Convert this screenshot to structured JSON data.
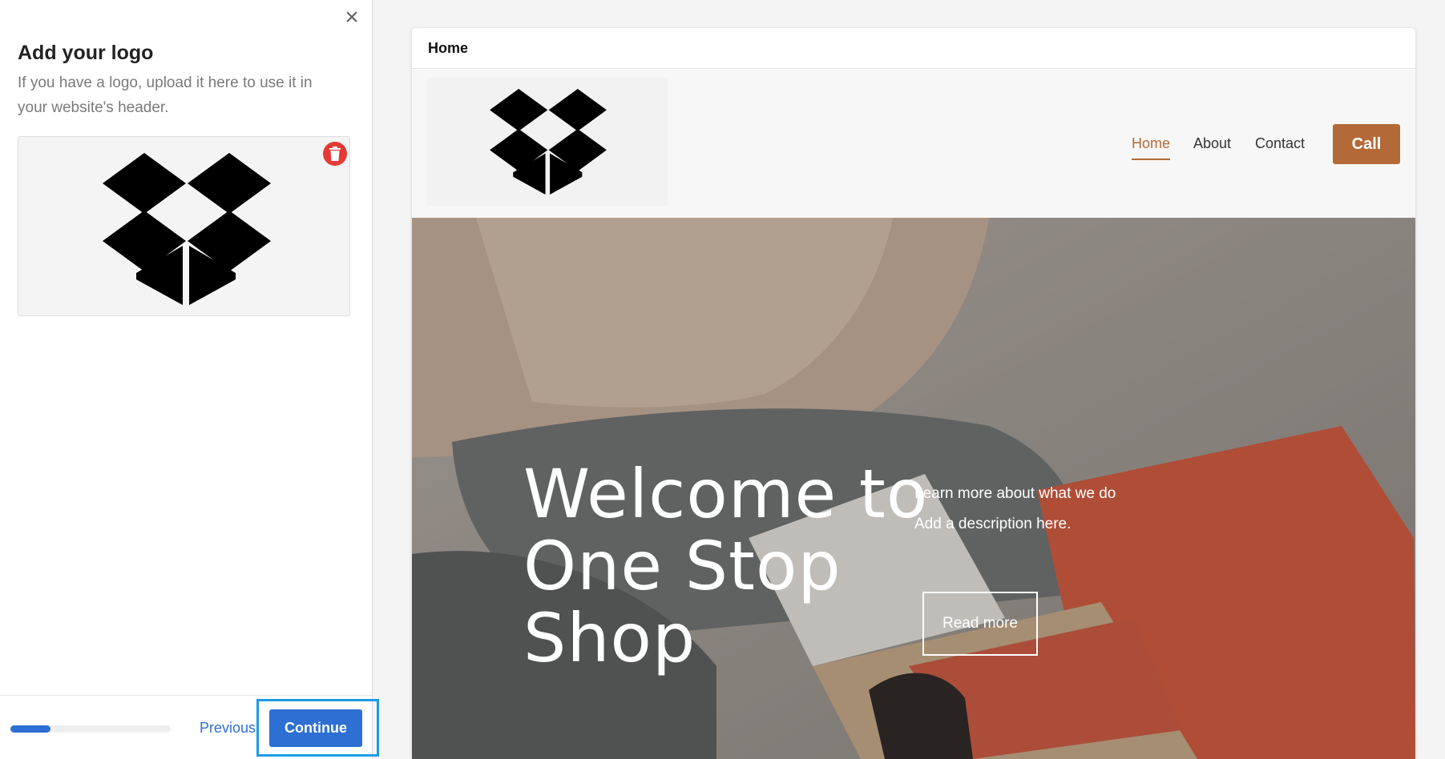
{
  "panel": {
    "title": "Add your logo",
    "description": "If you have a logo, upload it here to use it in your website's header.",
    "close_icon": "close-icon",
    "trash_icon": "trash-icon",
    "progress": 0.25,
    "previous_label": "Previous",
    "continue_label": "Continue"
  },
  "preview": {
    "tab_label": "Home",
    "nav": {
      "home": "Home",
      "about": "About",
      "contact": "Contact",
      "call": "Call"
    },
    "hero": {
      "title": "Welcome to One Stop Shop",
      "subtitle_1": "Learn more about what we do",
      "subtitle_2": "Add a description here.",
      "button": "Read more"
    }
  },
  "colors": {
    "accent": "#b36a38",
    "primary": "#2d6fd2",
    "highlight": "#1b9be6",
    "delete": "#e63a36"
  }
}
